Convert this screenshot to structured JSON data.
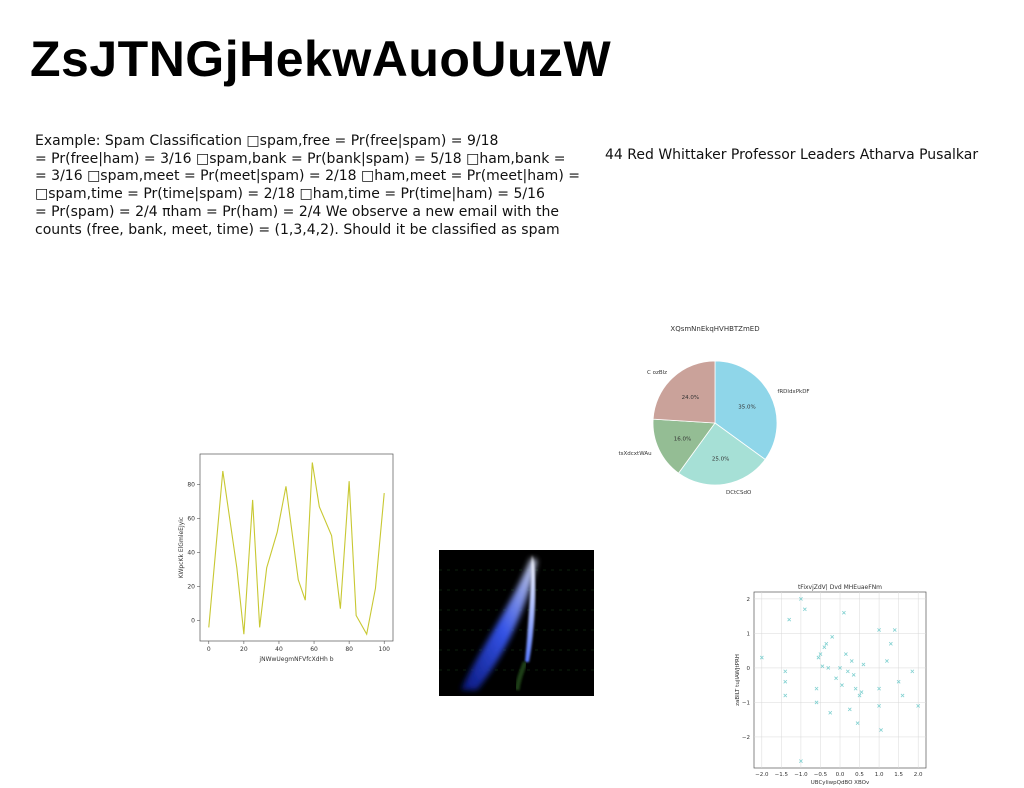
{
  "title": "ZsJTNGjHekwAuoUuzW",
  "body_text": {
    "lines": [
      "Example: Spam Classification □spam,free = Pr(free|spam) = 9/18",
      "= Pr(free|ham) = 3/16 □spam,bank = Pr(bank|spam) = 5/18 □ham,bank =",
      "= 3/16 □spam,meet = Pr(meet|spam) = 2/18 □ham,meet = Pr(meet|ham) =",
      "□spam,time = Pr(time|spam) = 2/18 □ham,time = Pr(time|ham) = 5/16",
      "= Pr(spam) = 2/4 πham = Pr(ham) = 2/4 We observe a new email with the",
      "counts (free, bank, meet, time) = (1,3,4,2). Should it be classified as spam"
    ]
  },
  "caption": "44 Red Whittaker Professor Leaders Atharva Pusalkar",
  "chart_data": [
    {
      "type": "pie",
      "title": "XQsmNnEkqHVHBTZmED",
      "labels": [
        "fRDldxPkDF",
        "DCtCSdO",
        "tsXdcxtWAu",
        "C ozBlz"
      ],
      "values": [
        35.0,
        25.0,
        16.0,
        24.0
      ],
      "value_labels": [
        "35.0%",
        "25.0%",
        "16.0%",
        "24.0%"
      ],
      "colors": [
        "#8fd6e9",
        "#a6e0d6",
        "#94bd94",
        "#caa29a"
      ],
      "start_angle": 90,
      "direction": "clockwise"
    },
    {
      "type": "line",
      "title": "",
      "xlabel": "jNWwUegmNFVfcXdHh b",
      "ylabel": "KWpcKk ElGmleEJyic",
      "x": [
        0,
        8,
        16,
        20,
        25,
        29,
        33,
        39,
        44,
        51,
        55,
        59,
        63,
        70,
        75,
        80,
        84,
        90,
        95,
        100
      ],
      "y": [
        -4,
        88,
        31,
        -8,
        71,
        -4,
        31,
        52,
        79,
        24,
        12,
        93,
        67,
        50,
        7,
        82,
        3,
        -8,
        19,
        75
      ],
      "xlim": [
        -5,
        105
      ],
      "ylim": [
        -12,
        98
      ],
      "xticks": [
        "0",
        "20",
        "40",
        "60",
        "80",
        "100"
      ],
      "yticks": [
        "0",
        "20",
        "40",
        "60",
        "80"
      ],
      "color": "#c8c832",
      "grid": false
    },
    {
      "type": "scatter",
      "title": "tFixvjZdV| Dvd MHEuaeFNm",
      "xlabel": "UBCyliwpQdBO XBOv",
      "ylabel": "zaBILT tujIAWJtPRH",
      "xlim": [
        -2.2,
        2.2
      ],
      "ylim": [
        -2.9,
        2.2
      ],
      "xticks": [
        "−2.0",
        "−1.5",
        "−1.0",
        "−0.5",
        "0.0",
        "0.5",
        "1.0",
        "1.5",
        "2.0"
      ],
      "yticks": [
        "−2",
        "−1",
        "0",
        "1",
        "2"
      ],
      "marker": "x",
      "color": "#7fd0d0",
      "grid": true,
      "points": [
        [
          -1.0,
          2.0
        ],
        [
          -0.9,
          1.7
        ],
        [
          -1.3,
          1.4
        ],
        [
          -2.0,
          0.3
        ],
        [
          -1.4,
          -0.1
        ],
        [
          -1.4,
          -0.4
        ],
        [
          -1.4,
          -0.8
        ],
        [
          -1.0,
          -2.7
        ],
        [
          -0.6,
          -0.6
        ],
        [
          -0.6,
          -1.0
        ],
        [
          -0.55,
          0.3
        ],
        [
          -0.5,
          0.4
        ],
        [
          -0.45,
          0.05
        ],
        [
          -0.4,
          0.6
        ],
        [
          -0.35,
          0.7
        ],
        [
          -0.3,
          0.0
        ],
        [
          -0.25,
          -1.3
        ],
        [
          -0.2,
          0.9
        ],
        [
          -0.1,
          -0.3
        ],
        [
          0.0,
          0.0
        ],
        [
          0.05,
          -0.5
        ],
        [
          0.1,
          1.6
        ],
        [
          0.15,
          0.4
        ],
        [
          0.2,
          -0.1
        ],
        [
          0.25,
          -1.2
        ],
        [
          0.3,
          0.2
        ],
        [
          0.35,
          -0.2
        ],
        [
          0.4,
          -0.6
        ],
        [
          0.45,
          -1.6
        ],
        [
          0.5,
          -0.8
        ],
        [
          0.55,
          -0.7
        ],
        [
          0.6,
          0.1
        ],
        [
          1.0,
          1.1
        ],
        [
          1.0,
          -0.6
        ],
        [
          1.0,
          -1.1
        ],
        [
          1.05,
          -1.8
        ],
        [
          1.2,
          0.2
        ],
        [
          1.3,
          0.7
        ],
        [
          1.4,
          1.1
        ],
        [
          1.5,
          -0.4
        ],
        [
          1.6,
          -0.8
        ],
        [
          1.85,
          -0.1
        ],
        [
          2.0,
          -1.1
        ]
      ]
    }
  ]
}
